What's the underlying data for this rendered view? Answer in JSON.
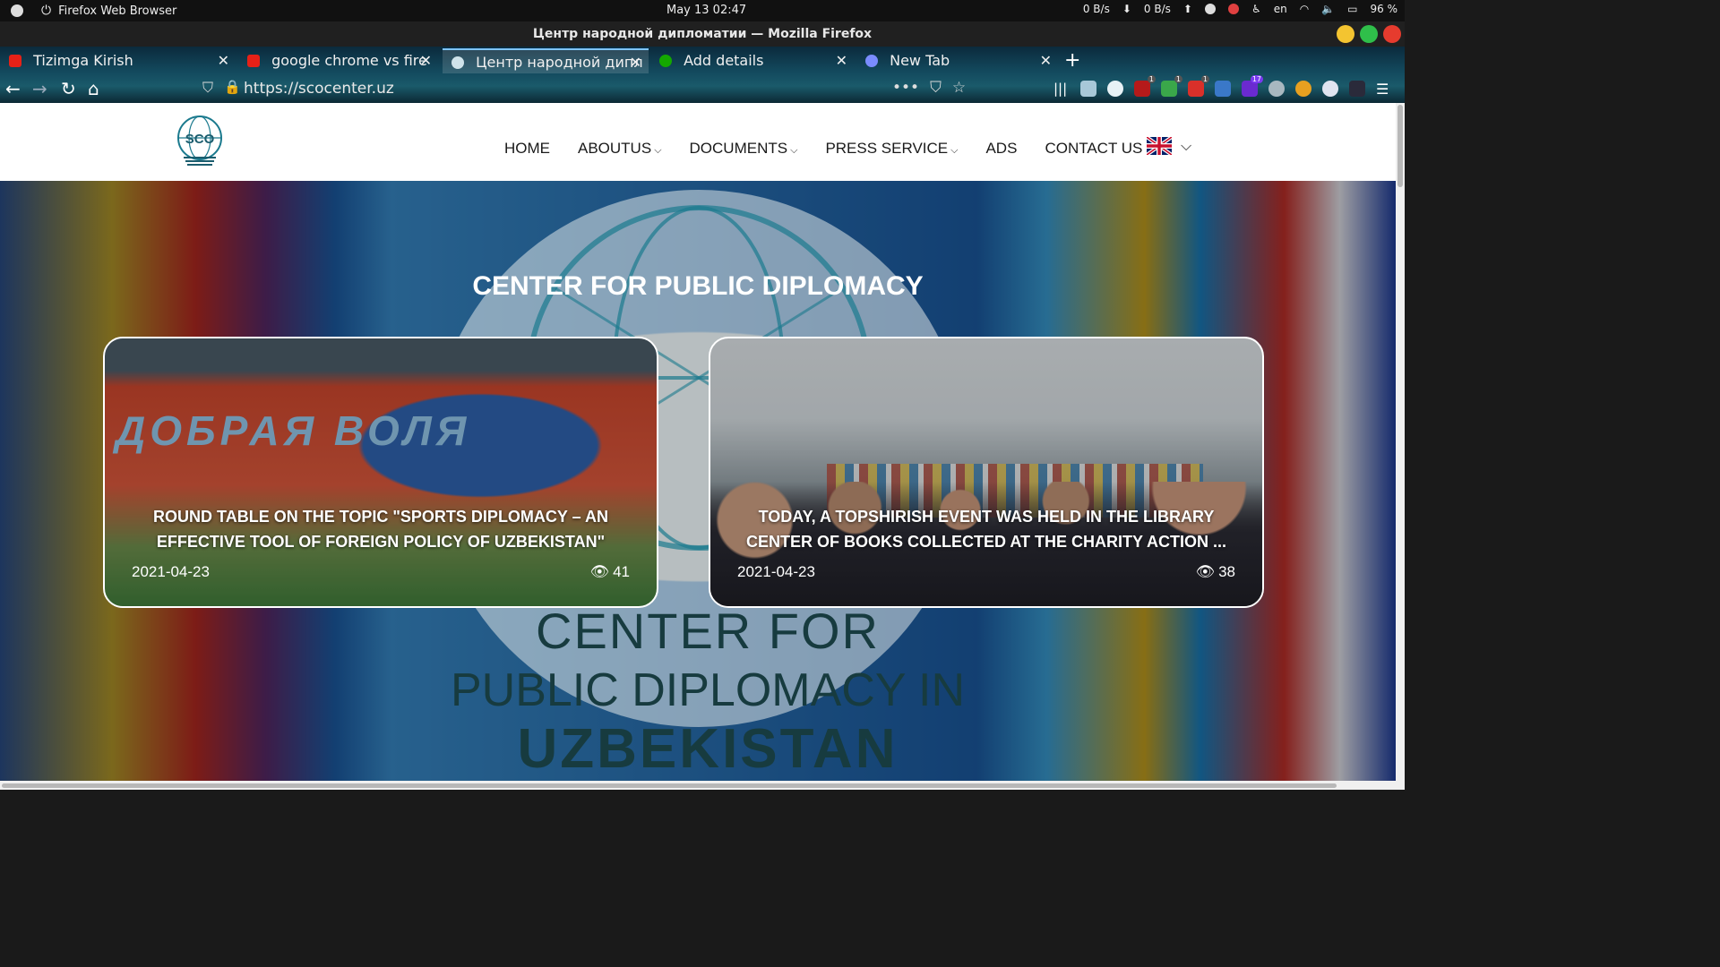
{
  "os": {
    "app_name": "Firefox Web Browser",
    "clock": "May 13  02:47",
    "net_down": "0 B/s",
    "net_up": "0 B/s",
    "keyboard_lang": "en",
    "battery": "96 %"
  },
  "window": {
    "title": "Центр народной дипломатии — Mozilla Firefox"
  },
  "tabs": [
    {
      "label": "Tizimga Kirish",
      "favicon": "youtube-icon",
      "color": "#e62117"
    },
    {
      "label": "google chrome vs fire",
      "favicon": "youtube-icon",
      "color": "#e62117"
    },
    {
      "label": "Центр народной дипл",
      "favicon": "sco-icon",
      "color": "#cfe3ea",
      "active": true
    },
    {
      "label": "Add details",
      "favicon": "upwork-icon",
      "color": "#14a800"
    },
    {
      "label": "New Tab",
      "favicon": "firefox-icon",
      "color": "#7a8cff"
    }
  ],
  "address_bar": {
    "url": "https://scocenter.uz"
  },
  "extensions": [
    {
      "name": "library-icon"
    },
    {
      "name": "reader-icon"
    },
    {
      "name": "L-icon"
    },
    {
      "name": "ublock-icon",
      "badge": "1"
    },
    {
      "name": "check-icon",
      "badge": "1"
    },
    {
      "name": "lock-icon",
      "badge": "1"
    },
    {
      "name": "fi-icon"
    },
    {
      "name": "purple-ext-icon",
      "badge": "17"
    },
    {
      "name": "globe-icon"
    },
    {
      "name": "color-icon"
    },
    {
      "name": "circle-icon"
    },
    {
      "name": "t-icon"
    },
    {
      "name": "menu-icon"
    }
  ],
  "site": {
    "logo_text": "SCO",
    "logo_caption": "CENTER FOR PUBLIC DIPLOMACY IN UZBEKISTAN",
    "menu": [
      {
        "label": "HOME",
        "dropdown": false
      },
      {
        "label": "ABOUTUS",
        "dropdown": true
      },
      {
        "label": "DOCUMENTS",
        "dropdown": true
      },
      {
        "label": "PRESS SERVICE",
        "dropdown": true
      },
      {
        "label": "ADS",
        "dropdown": false
      },
      {
        "label": "CONTACT US",
        "dropdown": false
      }
    ],
    "language_icon": "uk-flag-icon",
    "hero_title": "CENTER FOR PUBLIC DIPLOMACY",
    "emblem_lines": [
      "CENTER FOR",
      "PUBLIC DIPLOMACY IN",
      "UZBEKISTAN"
    ],
    "cards": [
      {
        "image_banner": "ДОБРАЯ ВОЛЯ",
        "title": "ROUND TABLE ON THE TOPIC \"SPORTS DIPLOMACY – AN EFFECTIVE TOOL OF FOREIGN POLICY OF UZBEKISTAN\"",
        "date": "2021-04-23",
        "views": "41"
      },
      {
        "title": "TODAY, A TOPSHIRISH EVENT WAS HELD IN THE LIBRARY CENTER OF BOOKS COLLECTED AT THE CHARITY ACTION ...",
        "date": "2021-04-23",
        "views": "38"
      }
    ]
  },
  "colors": {
    "accent": "#1b5d6e",
    "tab_indicator": "#7ec4ff"
  }
}
